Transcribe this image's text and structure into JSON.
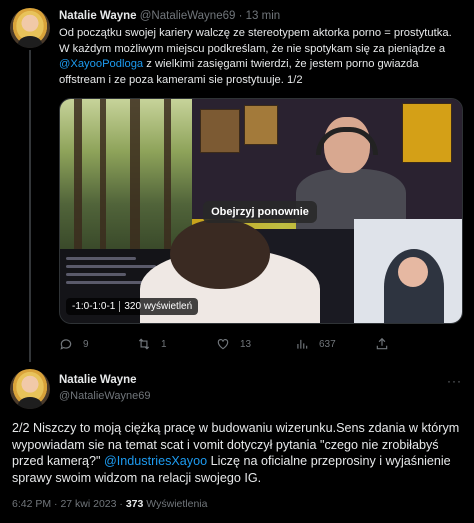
{
  "tweet1": {
    "author_name": "Natalie Wayne",
    "author_handle": "@NatalieWayne69",
    "separator": "·",
    "time_ago": "13 min",
    "text_before_mention": "Od początku swojej kariery walczę ze stereotypem aktorka porno = prostytutka. W każdym możliwym miejscu podkreślam, że nie spotykam się za pieniądze a ",
    "mention": "@XayooPodloga",
    "text_after_mention": " z wielkimi zasięgami twierdzi, że jestem porno gwiazda offstream i ze poza kamerami sie prostytuuje. 1/2",
    "media": {
      "replay_label": "Obejrzyj ponownie",
      "timestamp": "-1:0-1:0-1",
      "views": "320 wyświetleń"
    },
    "actions": {
      "replies": "9",
      "retweets": "1",
      "likes": "13",
      "views": "637"
    }
  },
  "tweet2": {
    "author_name": "Natalie Wayne",
    "author_handle": "@NatalieWayne69",
    "more_label": "···",
    "text_before_mention": "2/2 Niszczy to moją ciężką pracę w budowaniu wizerunku.Sens zdania w którym wypowiadam sie na temat scat i vomit dotyczył pytania \"czego nie zrobiłabyś przed kamerą?\" ",
    "mention": "@IndustriesXayoo",
    "text_after_mention": " Liczę na oficialne przeprosiny i wyjaśnienie sprawy swoim widzom na relacji swojego IG.",
    "time": "6:42 PM",
    "date": "27 kwi 2023",
    "views_count": "373",
    "views_label": "Wyświetlenia"
  },
  "colors": {
    "background": "#000000",
    "text": "#e7e9ea",
    "muted": "#71767b",
    "link": "#1d9bf0"
  },
  "icons": [
    "reply-icon",
    "retweet-icon",
    "like-icon",
    "views-icon",
    "share-icon",
    "more-icon"
  ]
}
